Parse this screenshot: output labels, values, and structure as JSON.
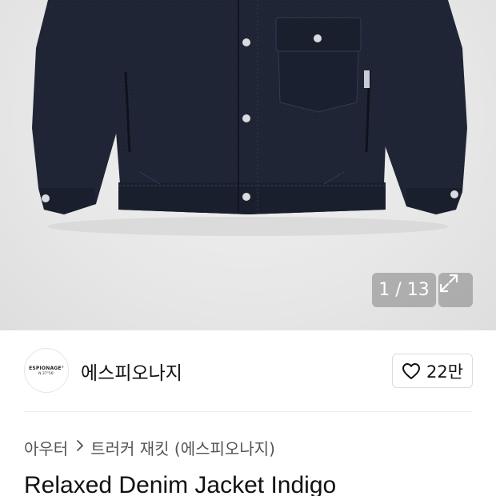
{
  "gallery": {
    "counter_text": "1 / 13",
    "expand_icon": "expand-icon"
  },
  "brand": {
    "logo_line1": "ESPIONAGE°",
    "logo_line2": "N.37°56'",
    "name": "에스피오나지",
    "like_icon": "heart-outline-icon",
    "like_count": "22만"
  },
  "breadcrumb": {
    "category": "아우터",
    "separator_icon": "chevron-right-icon",
    "subcategory": "트러커 재킷 (에스피오나지)"
  },
  "product": {
    "title": "Relaxed Denim Jacket Indigo"
  },
  "colors": {
    "denim": "#1c2233",
    "background": "#e8e8e8",
    "overlay": "#8a8a8a"
  }
}
